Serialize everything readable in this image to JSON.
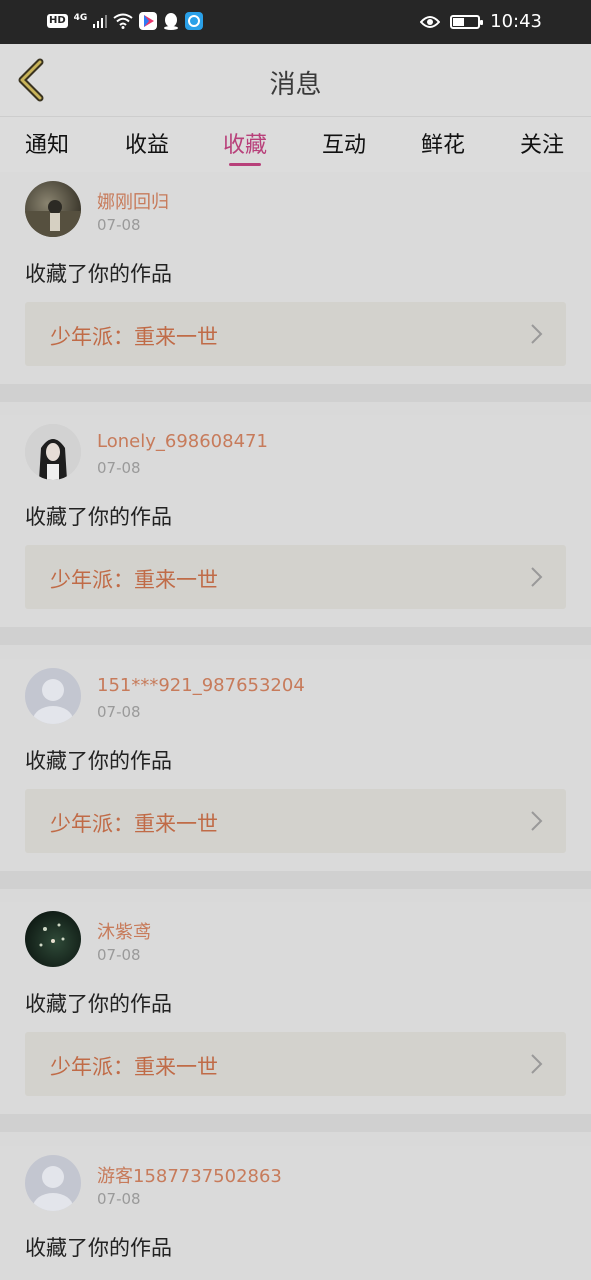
{
  "status_bar": {
    "badge": "HD",
    "network": "4G",
    "time": "10:43",
    "battery_level": 0.45
  },
  "header": {
    "title": "消息",
    "back_icon": "back-chevron-icon"
  },
  "tabs": [
    {
      "label": "通知"
    },
    {
      "label": "收益"
    },
    {
      "label": "收藏",
      "active": true
    },
    {
      "label": "互动"
    },
    {
      "label": "鲜花"
    },
    {
      "label": "关注"
    }
  ],
  "notifications": [
    {
      "username": "娜刚回归",
      "date": "07-08",
      "action": "收藏了你的作品",
      "work_title": "少年派：重来一世"
    },
    {
      "username": "Lonely_698608471",
      "date": "07-08",
      "action": "收藏了你的作品",
      "work_title": "少年派：重来一世"
    },
    {
      "username": "151***921_987653204",
      "date": "07-08",
      "action": "收藏了你的作品",
      "work_title": "少年派：重来一世"
    },
    {
      "username": "沐紫鸢",
      "date": "07-08",
      "action": "收藏了你的作品",
      "work_title": "少年派：重来一世"
    },
    {
      "username": "游客1587737502863",
      "date": "07-08",
      "action": "收藏了你的作品",
      "work_title": ""
    }
  ],
  "colors": {
    "accent": "#b8407a",
    "username": "#c77b5b",
    "work_title": "#c06b47"
  }
}
